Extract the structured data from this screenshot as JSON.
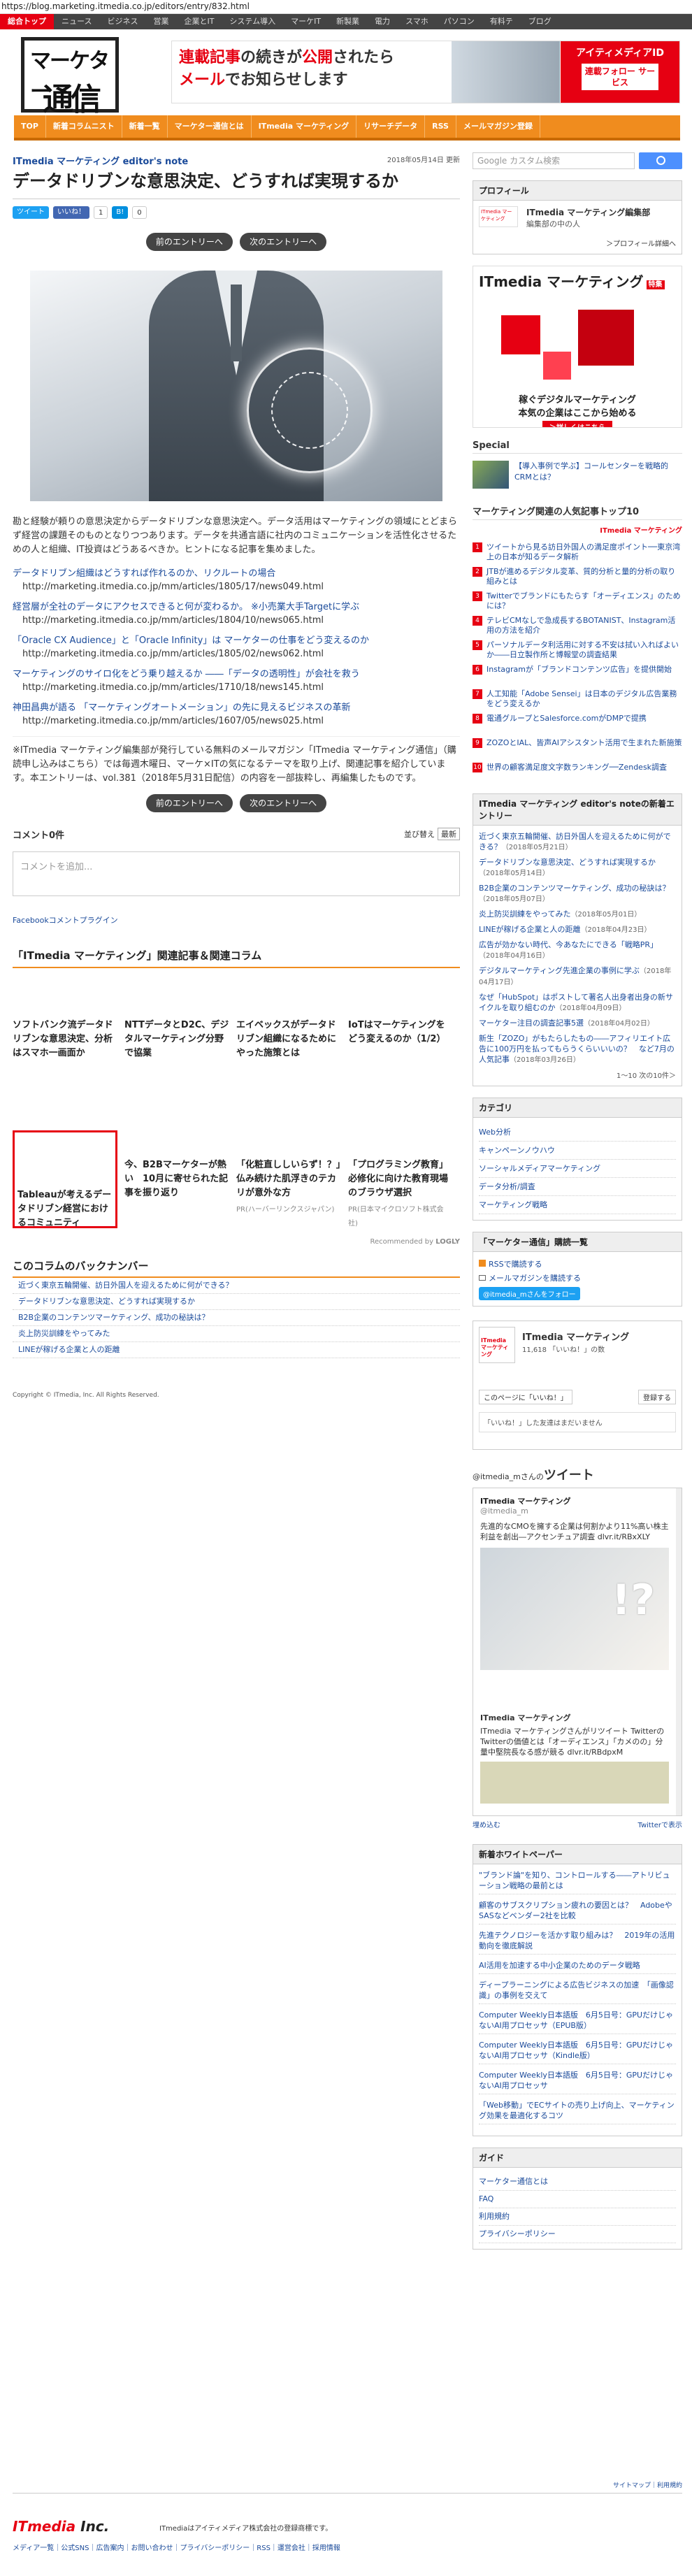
{
  "url": "https://blog.marketing.itmedia.co.jp/editors/entry/832.html",
  "globalnav": [
    "総合トップ",
    "ニュース",
    "ビジネス",
    "営業",
    "企業とIT",
    "システム導入",
    "マーケIT",
    "新製業",
    "電力",
    "スマホ",
    "パソコン",
    "有料テ",
    "ブログ"
  ],
  "logo": {
    "line1": "マーケター",
    "line2": "通信"
  },
  "banner": {
    "line1": "連載記事",
    "line1b": "の続きが",
    "line1c": "公開",
    "line1d": "されたら",
    "line2a": "メール",
    "line2b": "でお知らせします",
    "id_title": "アイティメディアID",
    "id_sub": "連載フォロー サービス"
  },
  "catnav": [
    "TOP",
    "新着コラムニスト",
    "新着一覧",
    "マーケター通信とは",
    "ITmedia マーケティング",
    "リサーチデータ",
    "RSS",
    "メールマガジン登録"
  ],
  "article": {
    "series": "ITmedia マーケティング editor's note",
    "date": "2018年05月14日 更新",
    "title": "データドリブンな意思決定、どうすれば実現するか",
    "tweet": "ツイート",
    "like": "いいね！",
    "like_count": "1",
    "hatena": "B!",
    "hatena_count": "0",
    "prev": "前のエントリーへ",
    "next": "次のエントリーへ",
    "lead": "勘と経験が頼りの意思決定からデータドリブンな意思決定へ。データ活用はマーケティングの領域にとどまらず経営の課題そのものとなりつつあります。データを共通言語に社内のコミュニケーションを活性化させるための人と組織、IT投資はどうあるべきか。ヒントになる記事を集めました。",
    "links": [
      {
        "t": "データドリブン組織はどうすれば作れるのか、リクルートの場合",
        "u": "http://marketing.itmedia.co.jp/mm/articles/1805/17/news049.html"
      },
      {
        "t": "経営層が全社のデータにアクセスできると何が変わるか。 ※小売業大手Targetに学ぶ",
        "u": "http://marketing.itmedia.co.jp/mm/articles/1804/10/news065.html"
      },
      {
        "t": "「Oracle CX Audience」と「Oracle Infinity」は マーケターの仕事をどう変えるのか",
        "u": "http://marketing.itmedia.co.jp/mm/articles/1805/02/news062.html"
      },
      {
        "t": "マーケティングのサイロ化をどう乗り越えるか ――「データの透明性」が会社を救う",
        "u": "http://marketing.itmedia.co.jp/mm/articles/1710/18/news145.html"
      },
      {
        "t": "神田昌典が語る 「マーケティングオートメーション」の先に見えるビジネスの革新",
        "u": "http://marketing.itmedia.co.jp/mm/articles/1607/05/news025.html"
      }
    ],
    "note": "※ITmedia マーケティング編集部が発行している無料のメールマガジン「ITmedia マーケティング通信」（購読申し込みはこちら）では毎週木曜日、マーケ×ITの気になるテーマを取り上げ、関連記事を紹介しています。本エントリーは、vol.381（2018年5月31日配信）の内容を一部抜粋し、再編集したものです。"
  },
  "comments": {
    "count": "コメント0件",
    "sort_label": "並び替え",
    "sort_value": "最新",
    "placeholder": "コメントを追加...",
    "plugin": "Facebookコメントプラグイン"
  },
  "related": {
    "heading": "「ITmedia マーケティング」関連記事＆関連コラム",
    "items": [
      "ソフトバンク流データドリブンな意思決定、分析はスマホ一画面か",
      "NTTデータとD2C、デジタルマーケティング分野で協業",
      "エイベックスがデータドリブン組織になるためにやった施策とは",
      "IoTはマーケティングをどう変えるのか（1/2）"
    ],
    "ads": [
      {
        "t": "Tableauが考えるデータドリブン経営におけるコミュニティ",
        "s": ""
      },
      {
        "t": "今、B2Bマーケターが熱い　10月に寄せられた記事を振り返り",
        "s": ""
      },
      {
        "t": "「化粧直ししいらず！？」仏み続けた肌浮きのテカリが意外な方",
        "s": "PR(ハーバーリンクスジャパン)"
      },
      {
        "t": "「プログラミング教育」必修化に向けた教育現場のブラウザ選択",
        "s": "PR(日本マイクロソフト株式会社)"
      }
    ],
    "recommended": "Recommended by",
    "logly": "LOGLY"
  },
  "backnumber": {
    "heading": "このコラムのバックナンバー",
    "items": [
      "近づく東京五輪開催、訪日外国人を迎えるために何ができる？",
      "データドリブンな意思決定、どうすれば実現するか",
      "B2B企業のコンテンツマーケティング、成功の秘訣は？",
      "炎上防災訓練をやってみた",
      "LINEが稼げる企業と人の距離"
    ]
  },
  "copyright": "Copyright © ITmedia, Inc. All Rights Reserved.",
  "sidebar": {
    "search_placeholder": "Google カスタム検索",
    "profile_h": "プロフィール",
    "profile_name": "ITmedia マーケティング編集部",
    "profile_sub": "編集部の中の人",
    "profile_more": "＞プロフィール詳細へ",
    "mag_title": "ITmedia マーケティング",
    "mag_badge": "特集",
    "mag_line": "稼ぐデジタルマーケティング",
    "mag_line2": "本気の企業はここから始める",
    "mag_go": "＞詳しくはこちら",
    "special_h": "Special",
    "special_item": "【導入事例で学ぶ】コールセンターを戦略的CRMとは？",
    "rank_h": "マーケティング関連の人気記事トップ10",
    "rank_logo": "ITmedia マーケティング",
    "rank": [
      "ツイートから見る訪日外国人の満足度ポイント──東京湾上の日本が知るデータ解析",
      "JTBが進めるデジタル変革、質的分析と量的分析の取り組みとは",
      "Twitterでブランドにもたらす「オーディエンス」のためには？",
      "テレビCMなしで急成長するBOTANIST、Instagram活用の方法を紹介",
      "パーソナルデータ利活用に対する不安は拭い入ればよいか――日立製作所と博報堂の調査結果",
      "Instagramが「ブランドコンテンツ広告」を提供開始",
      "人工知能「Adobe Sensei」は日本のデジタル広告業務をどう変えるか",
      "電通グループとSalesforce.comがDMPで提携",
      "ZOZOとIAL、皆声AIアシスタント活用で生まれた新施策",
      "世界の顧客満足度文字数ランキング──Zendesk調査"
    ],
    "arch_h": "ITmedia マーケティング editor's noteの新着エントリー",
    "arch": [
      {
        "t": "近づく東京五輪開催、訪日外国人を迎えるために何ができる？",
        "d": "（2018年05月21日）"
      },
      {
        "t": "データドリブンな意思決定、どうすれば実現するか",
        "d": "（2018年05月14日）"
      },
      {
        "t": "B2B企業のコンテンツマーケティング、成功の秘訣は？",
        "d": "（2018年05月07日）"
      },
      {
        "t": "炎上防災訓練をやってみた",
        "d": "（2018年05月01日）"
      },
      {
        "t": "LINEが稼げる企業と人の距離",
        "d": "（2018年04月23日）"
      },
      {
        "t": "広告が効かない時代、今あなたにできる「戦略PR」",
        "d": "（2018年04月16日）"
      },
      {
        "t": "デジタルマーケティング先進企業の事例に学ぶ",
        "d": "（2018年04月17日）"
      },
      {
        "t": "なぜ「HubSpot」はポストして著名人出身者出身の新サイクルを取り組むのか",
        "d": "（2018年04月09日）"
      },
      {
        "t": "マーケター注目の調査記事5選",
        "d": "（2018年04月02日）"
      },
      {
        "t": "新生「ZOZO」がもたらしたもの――アフィリエイト広告に100万円を払ってもらうくらいいいの？　など7月の人気記事",
        "d": "（2018年03月26日）"
      }
    ],
    "arch_pager": "1～10 次の10件＞",
    "cat_h": "カテゴリ",
    "cats": [
      "Web分析",
      "キャンペーンノウハウ",
      "ソーシャルメディアマーケティング",
      "データ分析/調査",
      "マーケティング戦略"
    ],
    "sub_h": "「マーケター通信」購読一覧",
    "subs": [
      "RSSで購読する",
      "メールマガジンを購読する"
    ],
    "tw_follow": "@itmedia_mさんをフォロー",
    "fb_name": "ITmedia マーケティング",
    "fb_logo": "ITmedia マーケティング",
    "fb_likes": "11,618 「いいね！」の数",
    "fb_like_btn": "このページに「いいね！」",
    "fb_reg_btn": "登録する",
    "fb_none": "「いいね！」した友達はまだいません",
    "tw_head_user": "@itmedia_mさんの",
    "tw_head": "ツイート",
    "tweet1_name": "ITmedia マーケティング",
    "tweet1_handle": "@itmedia_m",
    "tweet1_text": "先進的なCMOを擁する企業は何割かより11%高い株主利益を創出―アクセンチュア調査 dlvr.it/RBxXLY",
    "tweet2_name": "ITmedia マーケティング",
    "tweet2_text": "ITmedia マーケティングさんがリツイート TwitterのTwitterの価値とは「オーディエンス」「カメのの」分量中堅院長なる感が競る dlvr.it/RBdpxM",
    "tw_embed": "埋め込む",
    "tw_view": "Twitterで表示",
    "wp_h": "新着ホワイトペーパー",
    "wp": [
      "\"ブランド論\"を知り、コントロールする――アトリビューション戦略の最前とは",
      "顧客のサブスクリプション疲れの要因とは？　AdobeやSASなどベンダー2社を比較",
      "先進テクノロジーを活かす取り組みは？　2019年の活用動向を徹底解説",
      "AI活用を加速する中小企業のためのデータ戦略",
      "ディープラーニングによる広告ビジネスの加速　「画像認識」の事例を交えて",
      "Computer Weekly日本語版　6月5日号：GPUだけじゃないAI用プロセッサ（EPUB版）",
      "Computer Weekly日本語版　6月5日号：GPUだけじゃないAI用プロセッサ（Kindle版）",
      "Computer Weekly日本語版　6月5日号：GPUだけじゃないAI用プロセッサ",
      "「Web移動」でECサイトの売り上げ向上、マーケティング効果を最適化するコツ"
    ],
    "guide_h": "ガイド",
    "guide": [
      "マーケター通信とは",
      "FAQ",
      "利用規約",
      "プライバシーポリシー"
    ]
  },
  "footer": {
    "top": "サイトマップ｜利用規約",
    "logo_a": "ITmedia",
    "logo_b": "Inc.",
    "corp": "ITmediaはアイティメディア株式会社の登録商標です。",
    "links": "メディア一覧｜公式SNS｜広告案内｜お問い合わせ｜プライバシーポリシー｜RSS｜運営会社｜採用情報"
  }
}
